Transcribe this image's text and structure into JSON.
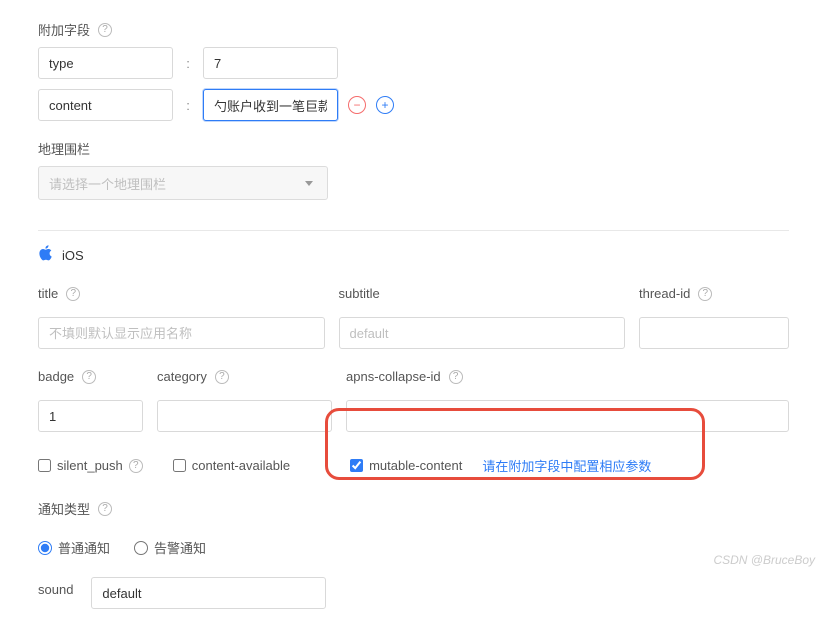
{
  "extraFields": {
    "label": "附加字段",
    "rows": [
      {
        "key": "type",
        "value": "7"
      },
      {
        "key": "content",
        "value": "勺账户收到一笔巨款"
      }
    ]
  },
  "geofence": {
    "label": "地理围栏",
    "placeholder": "请选择一个地理围栏"
  },
  "ios": {
    "header": "iOS",
    "title": {
      "label": "title",
      "placeholder": "不填则默认显示应用名称",
      "value": ""
    },
    "subtitle": {
      "label": "subtitle",
      "placeholder": "default",
      "value": ""
    },
    "threadId": {
      "label": "thread-id",
      "value": ""
    },
    "badge": {
      "label": "badge",
      "value": "1"
    },
    "category": {
      "label": "category",
      "value": ""
    },
    "apnsCollapseId": {
      "label": "apns-collapse-id",
      "value": ""
    },
    "silentPush": {
      "label": "silent_push",
      "checked": false
    },
    "contentAvailable": {
      "label": "content-available",
      "checked": false
    },
    "mutableContent": {
      "label": "mutable-content",
      "checked": true,
      "hint": "请在附加字段中配置相应参数"
    },
    "notifyType": {
      "label": "通知类型",
      "options": [
        {
          "label": "普通通知",
          "value": "normal",
          "selected": true
        },
        {
          "label": "告警通知",
          "value": "alert",
          "selected": false
        }
      ]
    },
    "sound": {
      "label": "sound",
      "value": "default"
    }
  },
  "watermark": "CSDN @BruceBoy"
}
